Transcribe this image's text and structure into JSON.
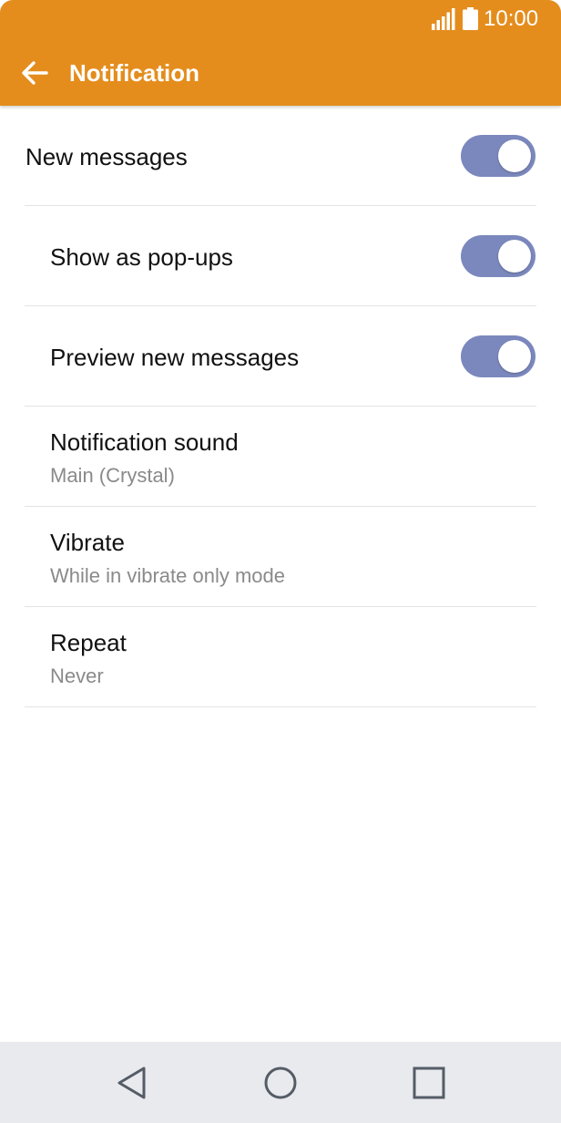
{
  "colors": {
    "app_bar": "#E48D1D",
    "toggle_on": "#7B88BD",
    "nav_icon": "#555c66"
  },
  "status_bar": {
    "time": "10:00",
    "icons": [
      "signal-icon",
      "battery-icon"
    ]
  },
  "header": {
    "title": "Notification",
    "back_icon": "arrow-left-icon"
  },
  "settings": [
    {
      "title": "New messages",
      "toggle": true,
      "toggle_on": true
    },
    {
      "title": "Show as pop-ups",
      "toggle": true,
      "toggle_on": true
    },
    {
      "title": "Preview new messages",
      "toggle": true,
      "toggle_on": true
    },
    {
      "title": "Notification sound",
      "subtitle": "Main (Crystal)"
    },
    {
      "title": "Vibrate",
      "subtitle": "While in vibrate only mode"
    },
    {
      "title": "Repeat",
      "subtitle": "Never"
    }
  ],
  "nav_bar": {
    "icons": [
      "back-triangle-icon",
      "home-circle-icon",
      "recents-square-icon"
    ]
  }
}
